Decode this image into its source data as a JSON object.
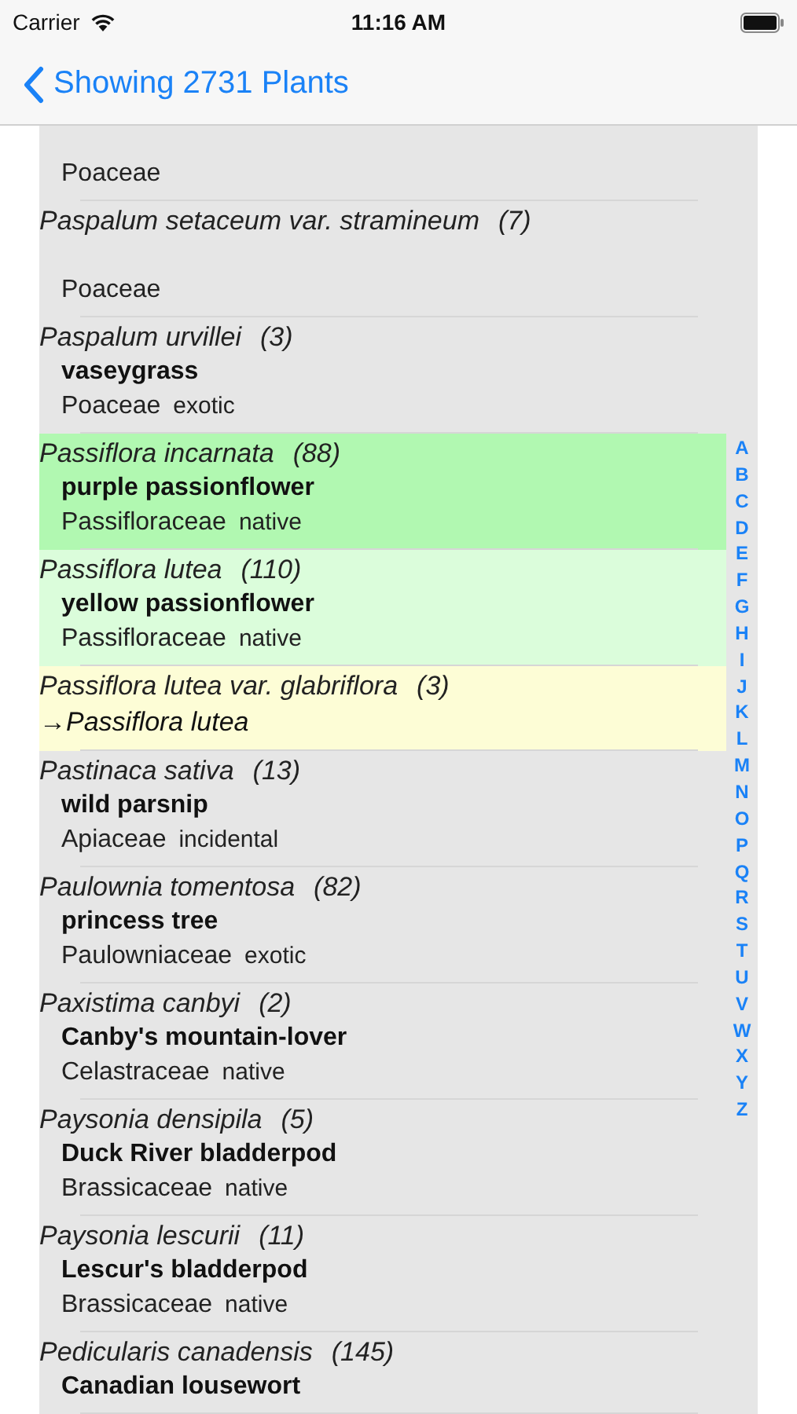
{
  "status_bar": {
    "carrier": "Carrier",
    "time": "11:16 AM"
  },
  "nav": {
    "back_label": "Showing 2731 Plants"
  },
  "plants": [
    {
      "kind": "plant",
      "color": "#e6e6e6",
      "family": "Poaceae"
    },
    {
      "kind": "plant",
      "color": "#e6e6e6",
      "name": "Paspalum setaceum var. stramineum",
      "count": "(7)",
      "family": "Poaceae"
    },
    {
      "kind": "plant",
      "color": "#e6e6e6",
      "name": "Paspalum urvillei",
      "count": "(3)",
      "common": "vaseygrass",
      "family": "Poaceae",
      "status": "exotic"
    },
    {
      "kind": "plant",
      "color": "#b1f8b1",
      "name": "Passiflora incarnata",
      "count": "(88)",
      "common": "purple passionflower",
      "family": "Passifloraceae",
      "status": "native"
    },
    {
      "kind": "plant",
      "color": "#dbfddb",
      "name": "Passiflora lutea",
      "count": "(110)",
      "common": "yellow passionflower",
      "family": "Passifloraceae",
      "status": "native"
    },
    {
      "kind": "synonym",
      "color": "#fdfdd6",
      "name": "Passiflora lutea var. glabriflora",
      "count": "(3)",
      "target": "→Passiflora lutea"
    },
    {
      "kind": "plant",
      "color": "#e6e6e6",
      "name": "Pastinaca sativa",
      "count": "(13)",
      "common": "wild parsnip",
      "family": "Apiaceae",
      "status": "incidental"
    },
    {
      "kind": "plant",
      "color": "#e6e6e6",
      "name": "Paulownia tomentosa",
      "count": "(82)",
      "common": "princess tree",
      "family": "Paulowniaceae",
      "status": "exotic"
    },
    {
      "kind": "plant",
      "color": "#e6e6e6",
      "name": "Paxistima canbyi",
      "count": "(2)",
      "common": "Canby's mountain-lover",
      "family": "Celastraceae",
      "status": "native"
    },
    {
      "kind": "plant",
      "color": "#e6e6e6",
      "name": "Paysonia densipila",
      "count": "(5)",
      "common": "Duck River bladderpod",
      "family": "Brassicaceae",
      "status": "native"
    },
    {
      "kind": "plant",
      "color": "#e6e6e6",
      "name": "Paysonia lescurii",
      "count": "(11)",
      "common": "Lescur's bladderpod",
      "family": "Brassicaceae",
      "status": "native"
    },
    {
      "kind": "plant",
      "color": "#e6e6e6",
      "name": "Pedicularis canadensis",
      "count": "(145)",
      "common": "Canadian lousewort"
    }
  ],
  "index": [
    "A",
    "B",
    "C",
    "D",
    "E",
    "F",
    "G",
    "H",
    "I",
    "J",
    "K",
    "L",
    "M",
    "N",
    "O",
    "P",
    "Q",
    "R",
    "S",
    "T",
    "U",
    "V",
    "W",
    "X",
    "Y",
    "Z"
  ]
}
